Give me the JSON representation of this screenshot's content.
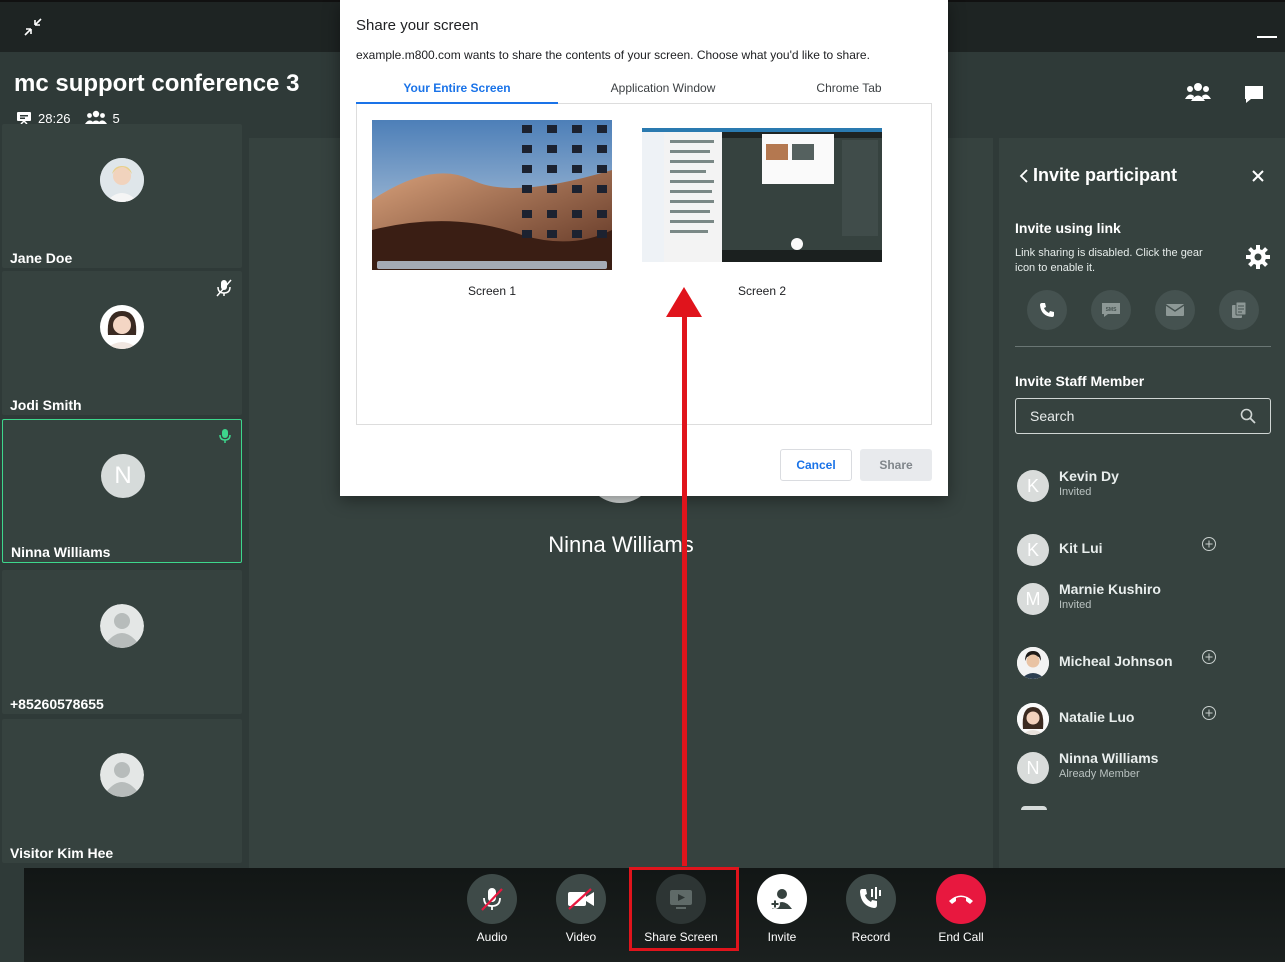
{
  "header": {
    "title": "mc support conference 3",
    "duration": "28:26",
    "participant_count": "5"
  },
  "participants": [
    {
      "name": "Jane Doe",
      "avatar": "photo"
    },
    {
      "name": "Jodi Smith",
      "avatar": "photo",
      "muted": true
    },
    {
      "name": "Ninna Williams",
      "avatar": "N",
      "active": true,
      "speaking": true
    },
    {
      "name": "+85260578655",
      "avatar": "default"
    },
    {
      "name": "Visitor Kim Hee",
      "avatar": "default"
    }
  ],
  "main_stage": {
    "name": "Ninna Williams"
  },
  "invite_panel": {
    "title": "Invite participant",
    "invite_link_heading": "Invite using link",
    "invite_link_note": "Link sharing is disabled. Click the gear icon to enable it.",
    "invite_methods": [
      "phone-icon",
      "sms-icon",
      "email-icon",
      "copy-icon"
    ],
    "staff_heading": "Invite Staff Member",
    "search_placeholder": "Search",
    "staff": [
      {
        "initial": "K",
        "name": "Kevin Dy",
        "status": "Invited"
      },
      {
        "initial": "K",
        "name": "Kit Lui",
        "status": ""
      },
      {
        "initial": "M",
        "name": "Marnie Kushiro",
        "status": "Invited"
      },
      {
        "initial": "",
        "name": "Micheal Johnson",
        "status": ""
      },
      {
        "initial": "",
        "name": "Natalie Luo",
        "status": ""
      },
      {
        "initial": "N",
        "name": "Ninna Williams",
        "status": "Already Member"
      }
    ]
  },
  "controls": {
    "audio": "Audio",
    "video": "Video",
    "share": "Share Screen",
    "invite": "Invite",
    "record": "Record",
    "end": "End Call"
  },
  "share_dialog": {
    "title": "Share your screen",
    "description": "example.m800.com wants to share the contents of your screen. Choose what you'd like to share.",
    "tabs": [
      "Your Entire Screen",
      "Application Window",
      "Chrome Tab"
    ],
    "active_tab": "Your Entire Screen",
    "screens": [
      "Screen 1",
      "Screen 2"
    ],
    "cancel_label": "Cancel",
    "share_label": "Share"
  },
  "colors": {
    "accent": "#1a73e8",
    "end_call": "#e8183f",
    "highlight": "#e0141c",
    "speaking": "#3dd68c"
  }
}
